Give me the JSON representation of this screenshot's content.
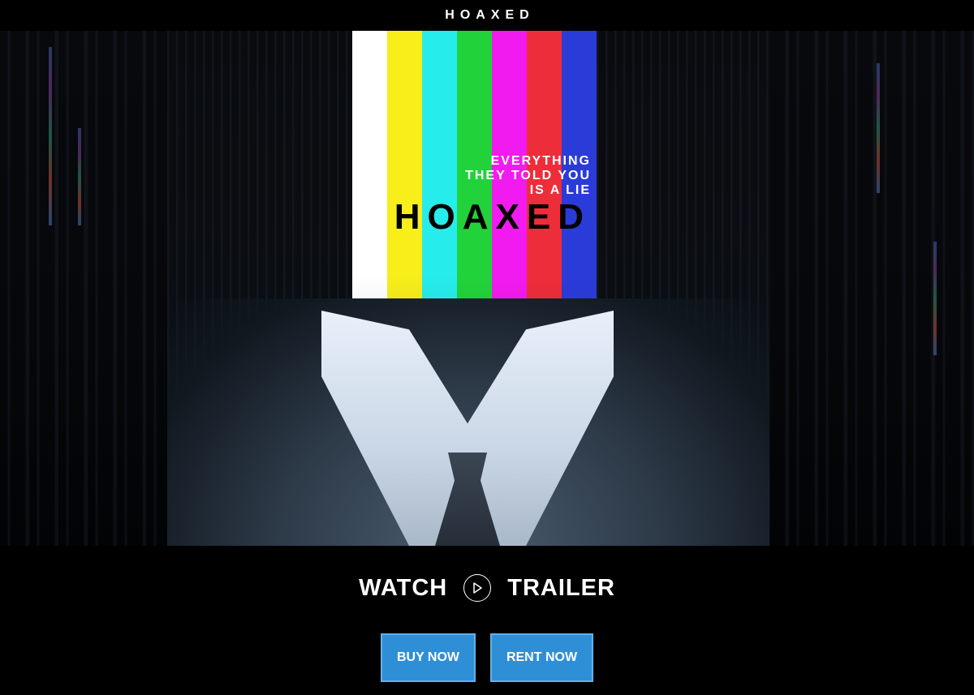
{
  "header": {
    "site_title": "HOAXED"
  },
  "poster": {
    "tagline": [
      "EVERYTHING",
      "THEY TOLD YOU",
      "IS A LIE"
    ],
    "title": "HOAXED",
    "color_bars": [
      "#ffffff",
      "#f7ee1a",
      "#27ecec",
      "#22d23b",
      "#f21bef",
      "#ee2d3a",
      "#2b3bd8"
    ]
  },
  "trailer": {
    "label_left": "WATCH",
    "label_right": "TRAILER",
    "icon": "play-icon"
  },
  "buttons": {
    "buy_label": "BUY NOW",
    "rent_label": "RENT NOW"
  },
  "colors": {
    "button_bg": "#2f8fd6",
    "background": "#000000"
  }
}
